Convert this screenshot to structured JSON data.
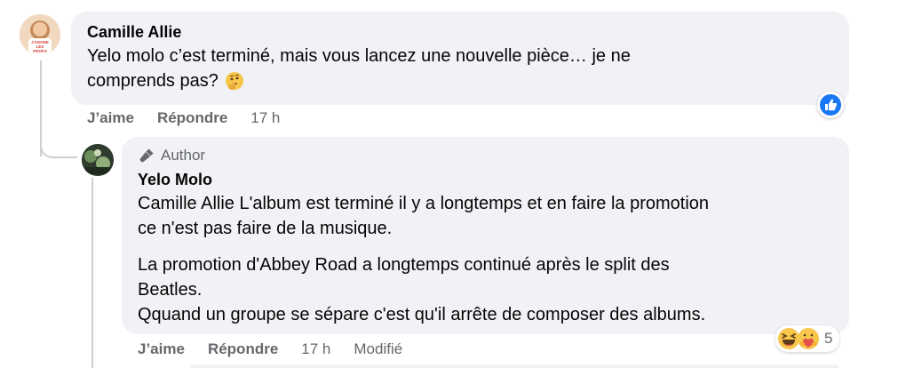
{
  "comments": [
    {
      "author": "Camille Allie",
      "text": "Yelo molo c’est terminé, mais vous lancez une nouvelle pièce… je ne comprends pas? 🤔",
      "line1": "Yelo molo c’est terminé, mais vous lancez une nouvelle pièce… je ne",
      "line2": "comprends pas?",
      "avatar_text": "J'ADORE LES PROFS",
      "actions": {
        "like": "J’aime",
        "reply": "Répondre",
        "time": "17 h"
      },
      "reaction_icon": "like-thumb-icon"
    },
    {
      "badge": "Author",
      "author": "Yelo Molo",
      "paragraphs": [
        {
          "lines": [
            "Camille Allie L'album est terminé il y a longtemps et en faire la promotion",
            "ce n'est pas faire de la musique."
          ]
        },
        {
          "lines": [
            "La promotion d'Abbey Road a longtemps continué après le split des",
            "Beatles.",
            "Qquand un groupe se sépare c'est qu'il arrête de composer des albums."
          ]
        }
      ],
      "actions": {
        "like": "J’aime",
        "reply": "Répondre",
        "time": "17 h",
        "edited": "Modifié"
      },
      "reactions": {
        "icons": [
          "haha-icon",
          "care-icon"
        ],
        "count": "5"
      }
    }
  ],
  "colors": {
    "bubble": "#f0f2f5",
    "text": "#050505",
    "secondary": "#65676b",
    "like_blue": "#1877f2",
    "thread_line": "#ced0d4"
  }
}
